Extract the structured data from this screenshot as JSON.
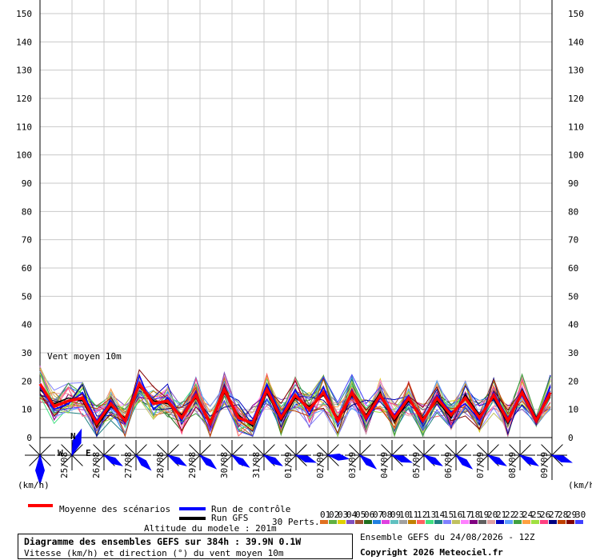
{
  "chart_data": {
    "type": "line",
    "title": "Diagramme des ensembles GEFS sur 384h : 39.9N 0.1W",
    "subtitle": "Vitesse (km/h) et direction (°) du vent moyen 10m",
    "series_title": "Vent moyen 10m",
    "ylabel_left": "(km/h)",
    "ylabel_right": "(km/h)",
    "ylim": [
      0,
      150
    ],
    "yticks": [
      0,
      10,
      20,
      30,
      40,
      50,
      60,
      70,
      80,
      90,
      100,
      110,
      120,
      130,
      140,
      150
    ],
    "grid": true,
    "date_labels": [
      "25/08",
      "26/08",
      "27/08",
      "28/08",
      "29/08",
      "30/08",
      "31/08",
      "01/09",
      "02/09",
      "03/09",
      "04/09",
      "05/09",
      "06/09",
      "07/09",
      "08/09",
      "09/09"
    ],
    "mean_series": {
      "name": "Moyenne des scénarios",
      "color": "#ff0000",
      "values": [
        19,
        11,
        13,
        14,
        5,
        12,
        6,
        19,
        12,
        13,
        7,
        15,
        5,
        17,
        7,
        5,
        17,
        7,
        15,
        10,
        16,
        6,
        16,
        7,
        15,
        7,
        14,
        6,
        14,
        8,
        14,
        7,
        15,
        6,
        16,
        6,
        16
      ]
    },
    "control_series": {
      "name": "Run de contrôle",
      "color": "#0000ff",
      "values": [
        18,
        10,
        12,
        16,
        6,
        13,
        5,
        22,
        10,
        14,
        6,
        16,
        4,
        18,
        6,
        6,
        19,
        8,
        17,
        8,
        18,
        5,
        17,
        6,
        14,
        8,
        15,
        5,
        15,
        9,
        12,
        6,
        16,
        7,
        15,
        5,
        18
      ]
    },
    "gfs_series": {
      "name": "Run GFS",
      "color": "#000000",
      "values": [
        17,
        12,
        14,
        13,
        4,
        11,
        7,
        18,
        13,
        12,
        8,
        14,
        6,
        16,
        8,
        4,
        16,
        6,
        14,
        11,
        15,
        7,
        15,
        8,
        16,
        6,
        13,
        7,
        13,
        7,
        15,
        8,
        14,
        5,
        17,
        7,
        15
      ]
    },
    "perturbations": {
      "label": "30 Perts.",
      "ids": [
        "01",
        "02",
        "03",
        "04",
        "05",
        "06",
        "07",
        "08",
        "09",
        "10",
        "11",
        "12",
        "13",
        "14",
        "15",
        "16",
        "17",
        "18",
        "19",
        "20",
        "21",
        "22",
        "23",
        "24",
        "25",
        "26",
        "27",
        "28",
        "29",
        "30"
      ],
      "colors": [
        "#e07020",
        "#60b040",
        "#e0d000",
        "#8050c0",
        "#a05030",
        "#207020",
        "#2080e0",
        "#e040e0",
        "#60c0c0",
        "#a0a0a0",
        "#c08000",
        "#ff6060",
        "#40e080",
        "#208080",
        "#8080ff",
        "#c0c060",
        "#ff80ff",
        "#800080",
        "#606060",
        "#e0a0a0",
        "#0000c0",
        "#60a0ff",
        "#40a040",
        "#ffa040",
        "#a0e040",
        "#ff4080",
        "#000080",
        "#c04000",
        "#800000",
        "#4040ff"
      ]
    },
    "wind_directions_deg": [
      0,
      200,
      300,
      315,
      300,
      310,
      305,
      300,
      290,
      280,
      310,
      290,
      300,
      310,
      300,
      300,
      290
    ]
  },
  "legend": {
    "mean": "Moyenne des scénarios",
    "control": "Run de contrôle",
    "gfs": "Run GFS",
    "perts": "30 Perts."
  },
  "compass": {
    "n": "N",
    "w": "W",
    "e": "E"
  },
  "altitude": "Altitude du modele : 201m",
  "info": {
    "title": "Diagramme des ensembles GEFS sur 384h : 39.9N 0.1W",
    "subtitle": "Vitesse (km/h) et direction (°) du vent moyen 10m"
  },
  "run_info": "Ensemble GEFS du 24/08/2026 - 12Z",
  "copyright": "Copyright 2026 Meteociel.fr"
}
